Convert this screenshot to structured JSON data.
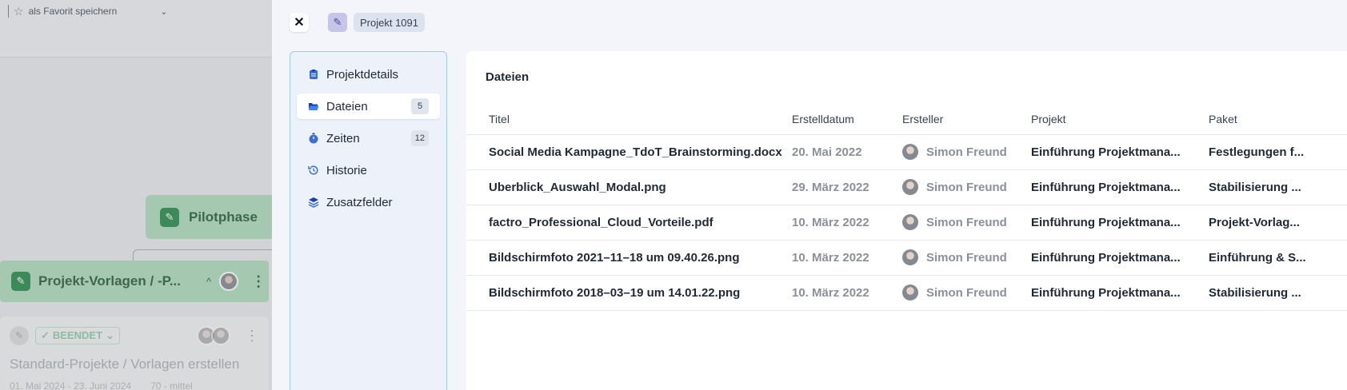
{
  "background": {
    "favorite_label": "als Favorit speichern",
    "phase_label": "Pilotphase",
    "template_title": "Projekt-Vorlagen / -P...",
    "task": {
      "status": "BEENDET",
      "title": "Standard-Projekte / Vorlagen erstellen",
      "dates": "01. Mai 2024 - 23. Juni 2024",
      "priority": "70 - mittel"
    }
  },
  "modal": {
    "project_label": "Projekt 1091",
    "nav": [
      {
        "label": "Projektdetails",
        "icon": "clipboard-icon",
        "count": ""
      },
      {
        "label": "Dateien",
        "icon": "folder-open-icon",
        "count": "5"
      },
      {
        "label": "Zeiten",
        "icon": "stopwatch-icon",
        "count": "12"
      },
      {
        "label": "Historie",
        "icon": "history-icon",
        "count": ""
      },
      {
        "label": "Zusatzfelder",
        "icon": "layers-icon",
        "count": ""
      }
    ],
    "section_title": "Dateien",
    "columns": {
      "title": "Titel",
      "created": "Erstelldatum",
      "creator": "Ersteller",
      "project": "Projekt",
      "package": "Paket"
    },
    "rows": [
      {
        "title": "Social Media Kampagne_TdoT_Brainstorming.docx",
        "date": "20. Mai 2022",
        "creator": "Simon Freund",
        "project": "Einführung Projektmana...",
        "package": "Festlegungen f..."
      },
      {
        "title": "Uberblick_Auswahl_Modal.png",
        "date": "29. März 2022",
        "creator": "Simon Freund",
        "project": "Einführung Projektmana...",
        "package": "Stabilisierung ..."
      },
      {
        "title": "factro_Professional_Cloud_Vorteile.pdf",
        "date": "10. März 2022",
        "creator": "Simon Freund",
        "project": "Einführung Projektmana...",
        "package": "Projekt-Vorlag..."
      },
      {
        "title": "Bildschirmfoto 2021–11–18 um 09.40.26.png",
        "date": "10. März 2022",
        "creator": "Simon Freund",
        "project": "Einführung Projektmana...",
        "package": "Einführung & S..."
      },
      {
        "title": "Bildschirmfoto 2018–03–19 um 14.01.22.png",
        "date": "10. März 2022",
        "creator": "Simon Freund",
        "project": "Einführung Projektmana...",
        "package": "Stabilisierung ..."
      }
    ]
  }
}
